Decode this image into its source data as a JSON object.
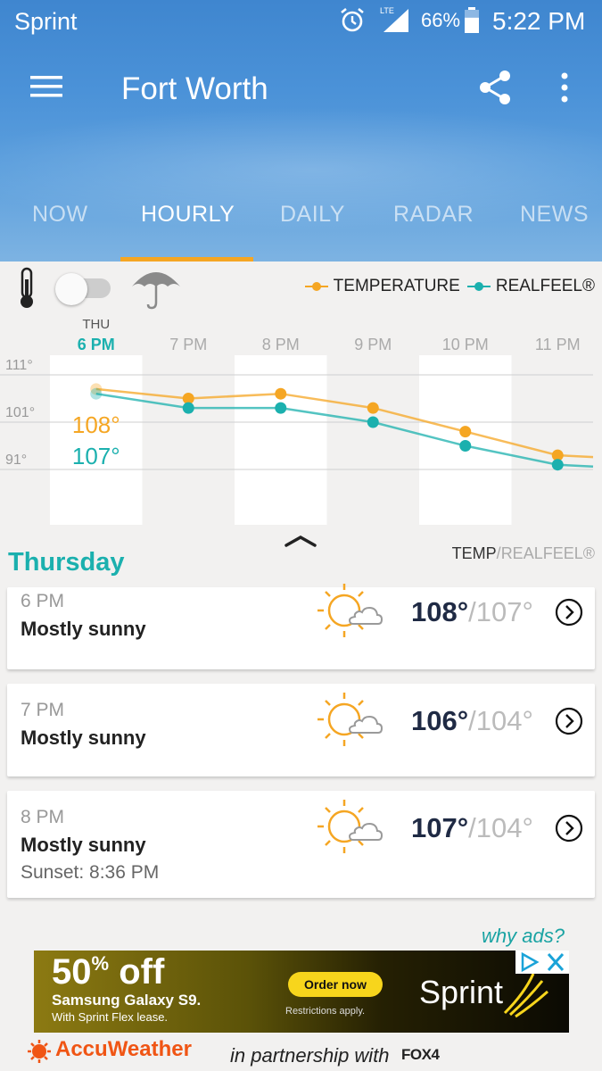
{
  "status_bar": {
    "carrier": "Sprint",
    "network": "LTE",
    "battery_percent": "66%",
    "battery_level": 0.66,
    "time": "5:22 PM"
  },
  "app_bar": {
    "location": "Fort Worth",
    "menu_icon": "hamburger-menu-icon",
    "share_icon": "share-icon",
    "overflow_icon": "more-vertical-icon"
  },
  "tabs": [
    {
      "label": "NOW",
      "active": false
    },
    {
      "label": "HOURLY",
      "active": true
    },
    {
      "label": "DAILY",
      "active": false
    },
    {
      "label": "RADAR",
      "active": false
    },
    {
      "label": "NEWS",
      "active": false
    }
  ],
  "colors": {
    "accent": "#f5a623",
    "temperature": "#f5a623",
    "realfeel": "#1bb0ae",
    "header": "#4b92d8"
  },
  "toolbar": {
    "thermometer_icon": "thermometer-icon",
    "umbrella_icon": "umbrella-icon",
    "toggle_on": false,
    "legend_temperature": "TEMPERATURE",
    "legend_realfeel": "REALFEEL®"
  },
  "chart_data": {
    "type": "line",
    "x": [
      "6 PM",
      "7 PM",
      "8 PM",
      "9 PM",
      "10 PM",
      "11 PM"
    ],
    "day_label": "THU",
    "y_ticks": [
      "111°",
      "101°",
      "91°"
    ],
    "ylim": [
      81,
      116
    ],
    "series": [
      {
        "name": "TEMPERATURE",
        "color": "#f5a623",
        "values": [
          108,
          106,
          107,
          104,
          99,
          94
        ]
      },
      {
        "name": "REALFEEL®",
        "color": "#1bb0ae",
        "values": [
          107,
          104,
          104,
          101,
          96,
          92
        ]
      }
    ],
    "highlight": {
      "index": 0,
      "temperature_label": "108°",
      "realfeel_label": "107°"
    }
  },
  "list": {
    "day_title": "Thursday",
    "column_label_temp": "TEMP",
    "column_label_separator": "/",
    "column_label_realfeel": "REALFEEL®",
    "items": [
      {
        "hour": "6 PM",
        "condition": "Mostly sunny",
        "extra": "",
        "temp": "108°",
        "realfeel": "107°",
        "icon": "mostly-sunny-icon"
      },
      {
        "hour": "7 PM",
        "condition": "Mostly sunny",
        "extra": "",
        "temp": "106°",
        "realfeel": "104°",
        "icon": "mostly-sunny-icon"
      },
      {
        "hour": "8 PM",
        "condition": "Mostly sunny",
        "extra": "Sunset: 8:36 PM",
        "temp": "107°",
        "realfeel": "104°",
        "icon": "mostly-sunny-icon"
      }
    ]
  },
  "ad": {
    "why_ads": "why ads?",
    "discount_number": "50",
    "discount_suffix": "off",
    "product": "Samsung Galaxy S9.",
    "fineprint": "With Sprint Flex lease.",
    "cta": "Order now",
    "restrictions": "Restrictions apply.",
    "brand": "Sprint"
  },
  "footer": {
    "brand": "AccuWeather",
    "partnership": "in partnership with",
    "partner": "FOX4"
  }
}
